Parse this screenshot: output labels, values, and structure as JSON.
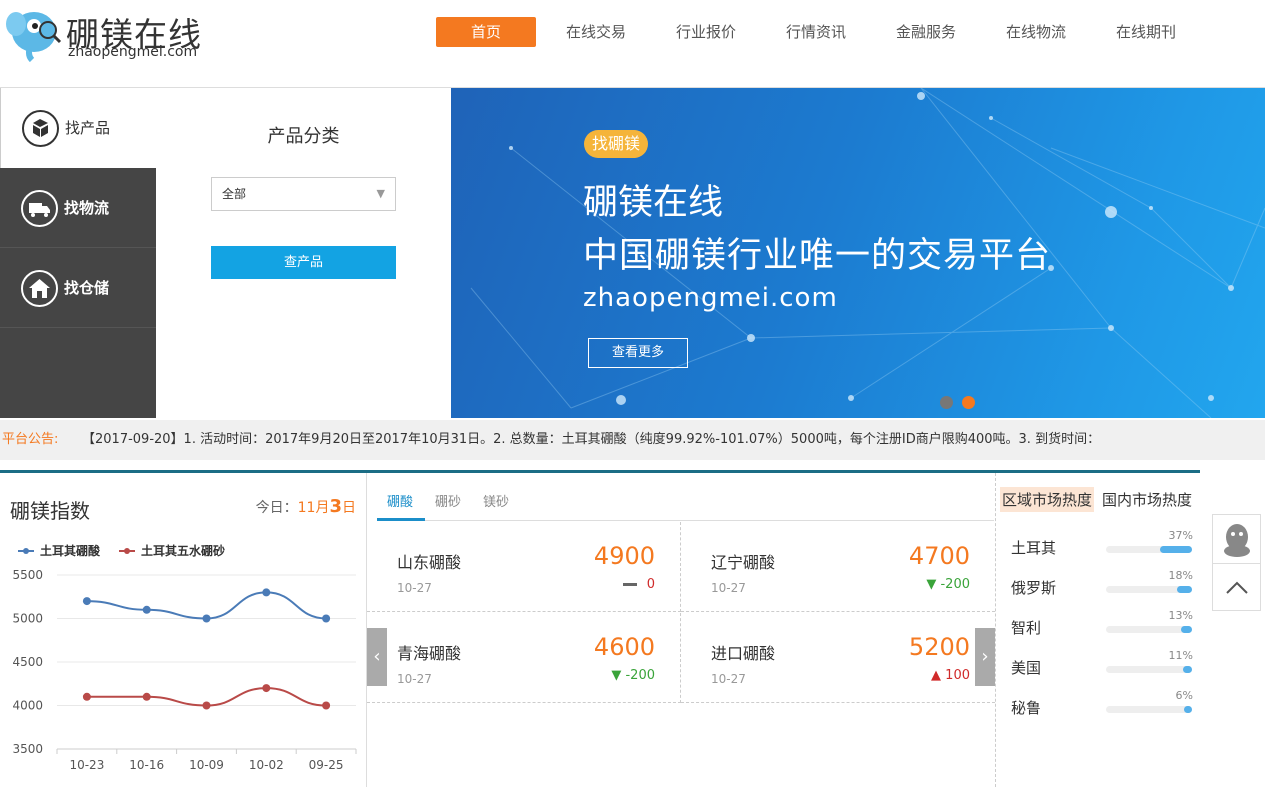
{
  "header": {
    "logo_cn": "硼镁在线",
    "logo_en": "zhaopengmei.com",
    "nav": [
      {
        "label": "首页",
        "active": true
      },
      {
        "label": "在线交易"
      },
      {
        "label": "行业报价"
      },
      {
        "label": "行情资讯"
      },
      {
        "label": "金融服务"
      },
      {
        "label": "在线物流"
      },
      {
        "label": "在线期刊"
      }
    ],
    "accent": "#f47920"
  },
  "sidebar": {
    "items": [
      {
        "label": "找产品",
        "icon": "box-icon",
        "selected": true
      },
      {
        "label": "找物流",
        "icon": "truck-icon"
      },
      {
        "label": "找仓储",
        "icon": "warehouse-icon"
      }
    ]
  },
  "filter": {
    "title": "产品分类",
    "select_value": "全部",
    "button": "查产品"
  },
  "banner": {
    "tag": "找硼镁",
    "line1": "硼镁在线",
    "line2": "中国硼镁行业唯一的交易平台",
    "line3": "zhaopengmei.com",
    "more": "查看更多",
    "slides": 2,
    "active_slide": 2
  },
  "notice": {
    "label": "平台公告:",
    "text": "【2017-09-20】1.    活动时间：2017年9月20日至2017年10月31日。2.    总数量：土耳其硼酸（纯度99.92%-101.07%）5000吨，每个注册ID商户限购400吨。3.    到货时间："
  },
  "index": {
    "title": "硼镁指数",
    "date_prefix": "今日：",
    "date_month": "11月",
    "date_day": "3",
    "date_suffix": "日"
  },
  "chart_data": {
    "type": "line",
    "categories": [
      "10-23",
      "10-16",
      "10-09",
      "10-02",
      "09-25"
    ],
    "series": [
      {
        "name": "土耳其硼酸",
        "values": [
          5200,
          5100,
          5000,
          5300,
          5000
        ],
        "color": "#4a7bb7"
      },
      {
        "name": "土耳其五水硼砂",
        "values": [
          4100,
          4100,
          4000,
          4200,
          4000
        ],
        "color": "#b94a48"
      }
    ],
    "yticks": [
      "5500",
      "5000",
      "4500",
      "4000",
      "3500"
    ],
    "ylim": [
      3500,
      5500
    ],
    "grid": true,
    "legend": "top-left"
  },
  "price_tabs": [
    {
      "label": "硼酸",
      "active": true
    },
    {
      "label": "硼砂"
    },
    {
      "label": "镁砂"
    }
  ],
  "prices": [
    {
      "name": "山东硼酸",
      "date": "10-27",
      "price": "4900",
      "change": "0",
      "dir": "flat"
    },
    {
      "name": "辽宁硼酸",
      "date": "10-27",
      "price": "4700",
      "change": "-200",
      "dir": "down"
    },
    {
      "name": "青海硼酸",
      "date": "10-27",
      "price": "4600",
      "change": "-200",
      "dir": "down"
    },
    {
      "name": "进口硼酸",
      "date": "10-27",
      "price": "5200",
      "change": "100",
      "dir": "up"
    }
  ],
  "heat": {
    "tab1": "区域市场热度",
    "tab2": "国内市场热度",
    "rows": [
      {
        "name": "土耳其",
        "pct": "37%",
        "value": 0.37
      },
      {
        "name": "俄罗斯",
        "pct": "18%",
        "value": 0.18
      },
      {
        "name": "智利",
        "pct": "13%",
        "value": 0.13
      },
      {
        "name": "美国",
        "pct": "11%",
        "value": 0.11
      },
      {
        "name": "秘鲁",
        "pct": "6%",
        "value": 0.06
      }
    ]
  }
}
